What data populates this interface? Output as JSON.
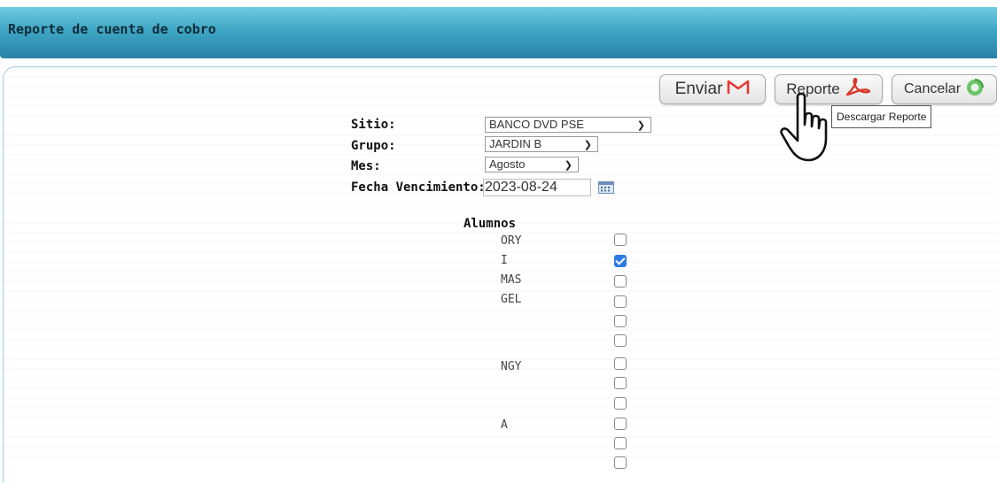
{
  "header": {
    "title": "Reporte de cuenta de cobro"
  },
  "toolbar": {
    "enviar_label": "Enviar",
    "reporte_label": "Reporte",
    "cancelar_label": "Cancelar",
    "reporte_tooltip": "Descargar Reporte"
  },
  "form": {
    "sitio_label": "Sitio:",
    "sitio_value": "BANCO DVD PSE",
    "grupo_label": "Grupo:",
    "grupo_value": "JARDIN B",
    "mes_label": "Mes:",
    "mes_value": "Agosto",
    "fecha_label": "Fecha Vencimiento:",
    "fecha_value": "2023-08-24"
  },
  "alumnos": {
    "heading": "Alumnos",
    "rows": [
      {
        "name_fragment": "ORY",
        "checked": false
      },
      {
        "name_fragment": "I",
        "checked": true
      },
      {
        "name_fragment": "MAS",
        "checked": false
      },
      {
        "name_fragment": "GEL",
        "checked": false
      },
      {
        "name_fragment": "",
        "checked": false
      },
      {
        "name_fragment": "",
        "checked": false
      },
      {
        "name_fragment": "NGY",
        "checked": false
      },
      {
        "name_fragment": "",
        "checked": false
      },
      {
        "name_fragment": "",
        "checked": false
      },
      {
        "name_fragment": "A",
        "checked": false
      },
      {
        "name_fragment": "",
        "checked": false
      },
      {
        "name_fragment": "",
        "checked": false
      }
    ]
  },
  "icons": {
    "enviar": "gmail-icon",
    "reporte": "pdf-icon",
    "cancelar": "refresh-icon",
    "calendar": "calendar-icon",
    "cursor": "hand-pointer-icon"
  },
  "colors": {
    "header_top": "#71cbe0",
    "header_bottom": "#2b82a6",
    "checkbox_checked": "#2a7be4",
    "gmail_red": "#e53935",
    "pdf_red": "#d93a2b",
    "refresh_green": "#5cb85c"
  }
}
